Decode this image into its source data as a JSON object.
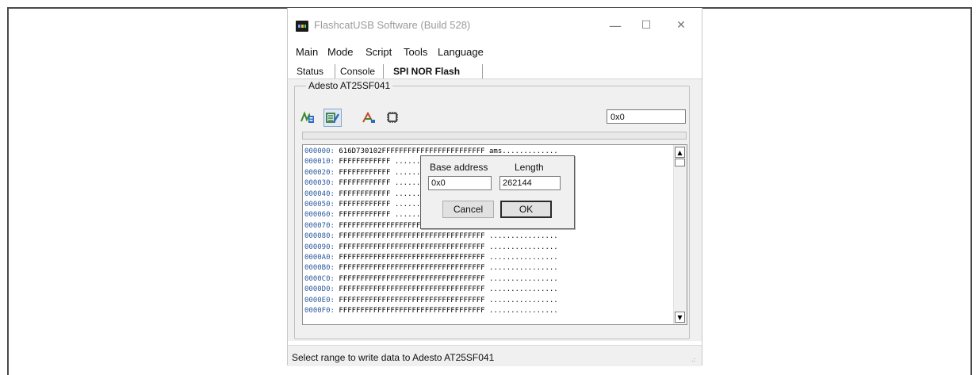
{
  "window": {
    "title": "FlashcatUSB Software (Build 528)",
    "minimize": "—",
    "maximize": "☐",
    "close": "✕"
  },
  "menu": [
    "Main",
    "Mode",
    "Script",
    "Tools",
    "Language"
  ],
  "tabs": [
    {
      "label": "Status",
      "active": false
    },
    {
      "label": "Console",
      "active": false
    },
    {
      "label": "SPI NOR Flash",
      "active": true
    }
  ],
  "device": {
    "name": "Adesto AT25SF041",
    "address": "0x0"
  },
  "toolbar": {
    "icons": [
      "read-flash-icon",
      "write-flash-icon",
      "erase-flash-icon",
      "chip-settings-icon"
    ]
  },
  "hex": {
    "rows": [
      {
        "addr": "000000:",
        "data": "616D730102FFFFFFFFFFFFFFFFFFFFFFFF",
        "ascii": "ams............."
      },
      {
        "addr": "000010:",
        "data": "FFFFFFFFFFFF",
        "ascii": "..............."
      },
      {
        "addr": "000020:",
        "data": "FFFFFFFFFFFF",
        "ascii": "..............."
      },
      {
        "addr": "000030:",
        "data": "FFFFFFFFFFFF",
        "ascii": "..............."
      },
      {
        "addr": "000040:",
        "data": "FFFFFFFFFFFF",
        "ascii": "..............."
      },
      {
        "addr": "000050:",
        "data": "FFFFFFFFFFFF",
        "ascii": "..............."
      },
      {
        "addr": "000060:",
        "data": "FFFFFFFFFFFF",
        "ascii": "..............."
      },
      {
        "addr": "000070:",
        "data": "FFFFFFFFFFFFFFFFFFFFFFFFFFFFFFFFFF",
        "ascii": "................"
      },
      {
        "addr": "000080:",
        "data": "FFFFFFFFFFFFFFFFFFFFFFFFFFFFFFFFFF",
        "ascii": "................"
      },
      {
        "addr": "000090:",
        "data": "FFFFFFFFFFFFFFFFFFFFFFFFFFFFFFFFFF",
        "ascii": "................"
      },
      {
        "addr": "0000A0:",
        "data": "FFFFFFFFFFFFFFFFFFFFFFFFFFFFFFFFFF",
        "ascii": "................"
      },
      {
        "addr": "0000B0:",
        "data": "FFFFFFFFFFFFFFFFFFFFFFFFFFFFFFFFFF",
        "ascii": "................"
      },
      {
        "addr": "0000C0:",
        "data": "FFFFFFFFFFFFFFFFFFFFFFFFFFFFFFFFFF",
        "ascii": "................"
      },
      {
        "addr": "0000D0:",
        "data": "FFFFFFFFFFFFFFFFFFFFFFFFFFFFFFFFFF",
        "ascii": "................"
      },
      {
        "addr": "0000E0:",
        "data": "FFFFFFFFFFFFFFFFFFFFFFFFFFFFFFFFFF",
        "ascii": "................"
      },
      {
        "addr": "0000F0:",
        "data": "FFFFFFFFFFFFFFFFFFFFFFFFFFFFFFFFFF",
        "ascii": "................"
      }
    ],
    "scroll_up": "▲",
    "scroll_down": "▼"
  },
  "dialog": {
    "base_label": "Base address",
    "length_label": "Length",
    "base_value": "0x0",
    "length_value": "262144",
    "cancel_label": "Cancel",
    "ok_label": "OK"
  },
  "status": {
    "text": "Select range to write data to Adesto AT25SF041",
    "grip": ".:"
  },
  "colors": {
    "panel": "#f0f0f0",
    "hex_address": "#2a5aa0"
  }
}
